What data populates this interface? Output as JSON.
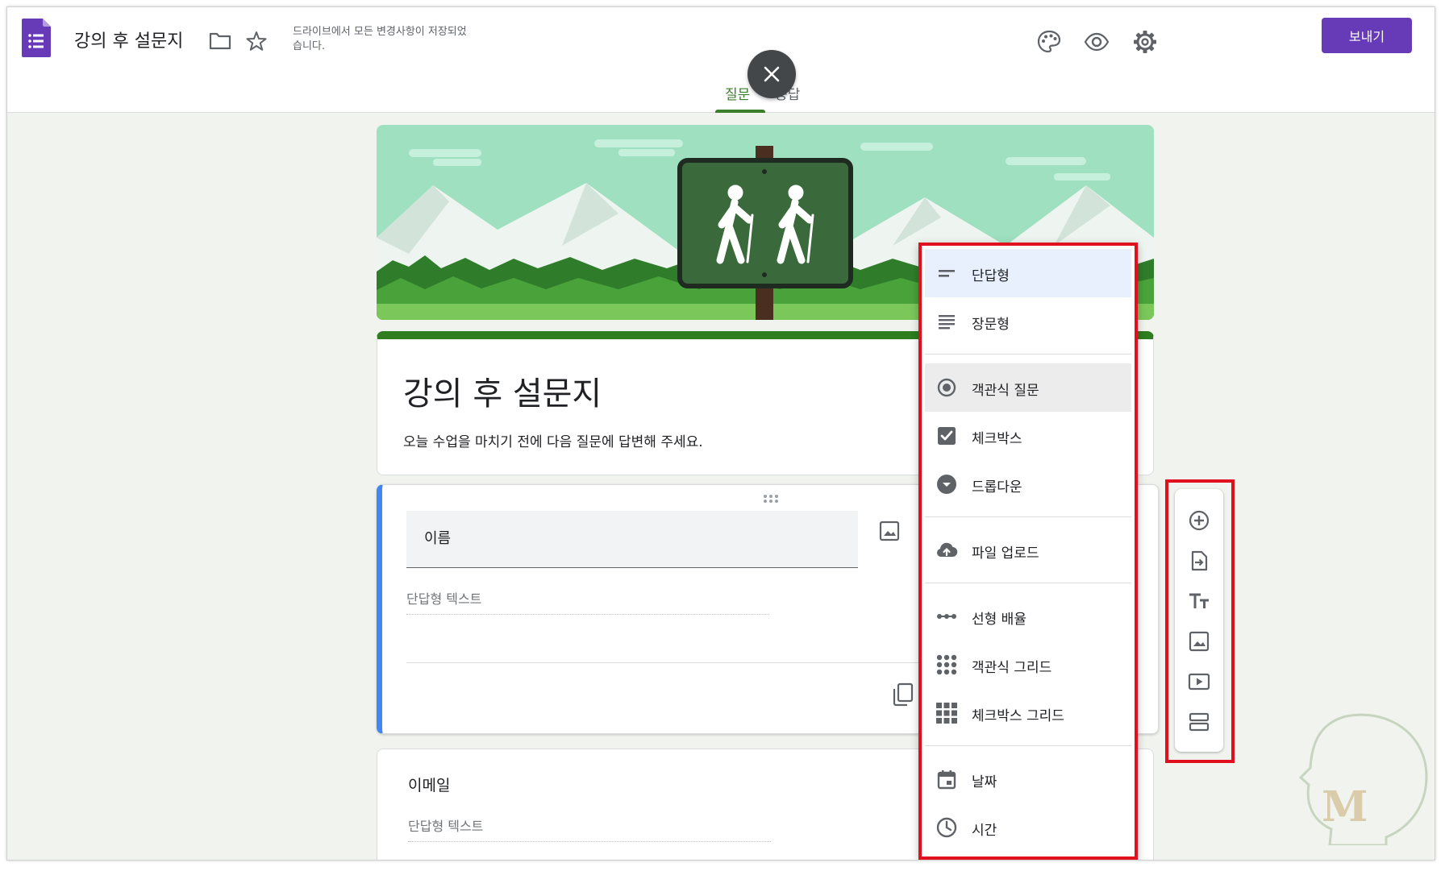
{
  "header": {
    "doc_title": "강의 후 설문지",
    "save_status": "드라이브에서 모든 변경사항이 저장되었습니다.",
    "send_label": "보내기",
    "icons": [
      "palette-icon",
      "preview-eye-icon",
      "settings-gear-icon",
      "folder-icon",
      "star-icon"
    ]
  },
  "tabs": {
    "questions": "질문",
    "responses": "응답",
    "active": "questions"
  },
  "form": {
    "title": "강의 후 설문지",
    "description": "오늘 수업을 마치기 전에 다음 질문에 답변해 주세요."
  },
  "questions": [
    {
      "title": "이름",
      "answer_placeholder": "단답형 텍스트"
    },
    {
      "title": "이메일",
      "answer_placeholder": "단답형 텍스트"
    }
  ],
  "question_type_menu": {
    "items": [
      {
        "label": "단답형",
        "icon": "short-answer-icon",
        "state": "selected"
      },
      {
        "label": "장문형",
        "icon": "paragraph-icon"
      },
      {
        "label": "객관식 질문",
        "icon": "radio-button-icon",
        "state": "hovered"
      },
      {
        "label": "체크박스",
        "icon": "checkbox-icon"
      },
      {
        "label": "드롭다운",
        "icon": "dropdown-circle-icon"
      },
      {
        "label": "파일 업로드",
        "icon": "cloud-upload-icon"
      },
      {
        "label": "선형 배율",
        "icon": "linear-scale-icon"
      },
      {
        "label": "객관식 그리드",
        "icon": "multiple-choice-grid-icon"
      },
      {
        "label": "체크박스 그리드",
        "icon": "checkbox-grid-icon"
      },
      {
        "label": "날짜",
        "icon": "calendar-icon"
      },
      {
        "label": "시간",
        "icon": "clock-icon"
      }
    ]
  },
  "side_toolbar": {
    "buttons": [
      "add-question-icon",
      "import-questions-icon",
      "add-title-text-icon",
      "add-image-icon",
      "add-video-icon",
      "add-section-icon"
    ]
  },
  "colors": {
    "accent_purple": "#673ab7",
    "theme_green": "#2e7d1f",
    "highlight_red": "#e0101f",
    "question_blue": "#4285f4"
  }
}
